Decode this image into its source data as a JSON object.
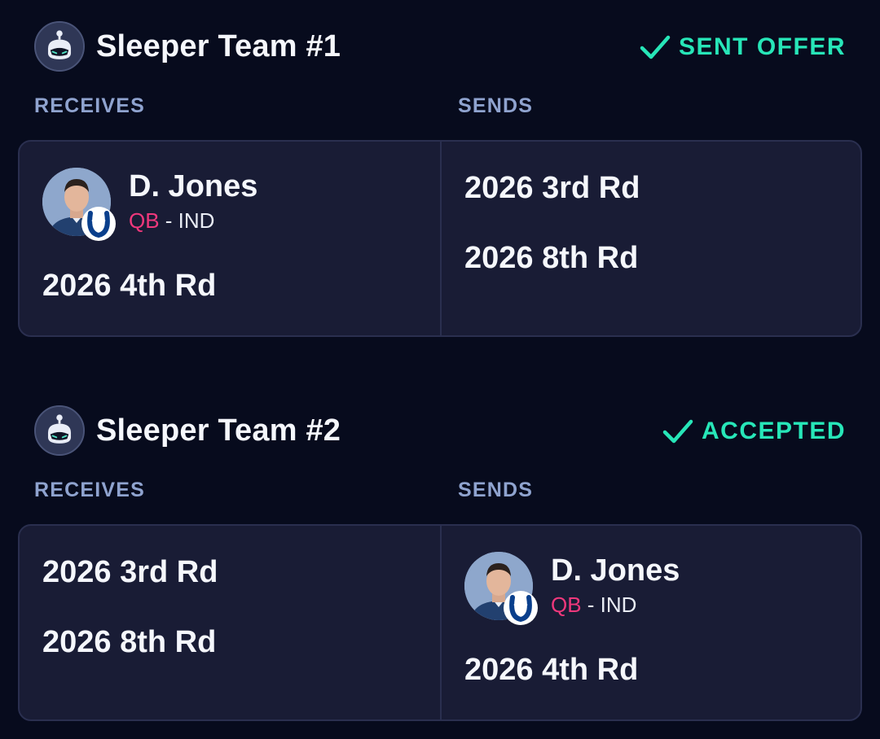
{
  "trades": [
    {
      "team_name": "Sleeper Team #1",
      "status": "SENT OFFER",
      "receives_label": "RECEIVES",
      "sends_label": "SENDS",
      "receives": {
        "player": {
          "name": "D. Jones",
          "position": "QB",
          "team_suffix": " - IND"
        },
        "picks": [
          "2026 4th Rd"
        ]
      },
      "sends": {
        "picks": [
          "2026 3rd Rd",
          "2026 8th Rd"
        ]
      }
    },
    {
      "team_name": "Sleeper Team #2",
      "status": "ACCEPTED",
      "receives_label": "RECEIVES",
      "sends_label": "SENDS",
      "receives": {
        "picks": [
          "2026 3rd Rd",
          "2026 8th Rd"
        ]
      },
      "sends": {
        "player": {
          "name": "D. Jones",
          "position": "QB",
          "team_suffix": " - IND"
        },
        "picks": [
          "2026 4th Rd"
        ]
      }
    }
  ],
  "colors": {
    "background": "#070b1d",
    "card": "#191c35",
    "status_accent": "#27e6b8",
    "position_accent": "#f0387c",
    "label": "#8fa3cf"
  },
  "icons": {
    "team_avatar": "sleeper-robot-avatar",
    "status": "check-icon",
    "player_photo": "player-headshot",
    "team_logo": "colts-horseshoe-logo"
  }
}
